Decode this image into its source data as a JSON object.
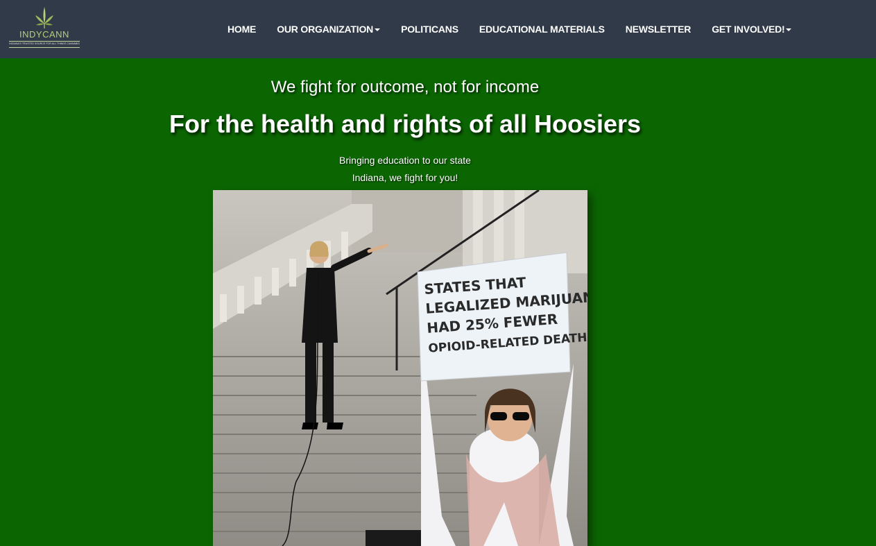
{
  "brand": {
    "name": "INDYCANN",
    "tagline": "INDIANA'S TRUSTED SOURCE FOR ALL THINGS CANNABIS"
  },
  "nav": {
    "items": [
      {
        "label": "HOME",
        "dropdown": false
      },
      {
        "label": "OUR ORGANIZATION",
        "dropdown": true
      },
      {
        "label": "POLITICANS",
        "dropdown": false
      },
      {
        "label": "EDUCATIONAL MATERIALS",
        "dropdown": false
      },
      {
        "label": "NEWSLETTER",
        "dropdown": false
      },
      {
        "label": "GET INVOLVED!",
        "dropdown": true
      }
    ]
  },
  "hero": {
    "tagline": "We fight for outcome, not for income",
    "headline": "For the health and rights of all Hoosiers",
    "sub_line_1": "Bringing education to our state",
    "sub_line_2": "Indiana, we fight for you!"
  },
  "photo": {
    "sign_lines": [
      "STATES THAT",
      "LEGALIZED MARIJUANA",
      "HAD 25% FEWER",
      "OPIOID-RELATED DEATHS."
    ]
  },
  "colors": {
    "page_background": "#0b6602",
    "navbar_background": "#303a48",
    "nav_text": "#ffffff",
    "logo_green": "#b6cf7a"
  }
}
